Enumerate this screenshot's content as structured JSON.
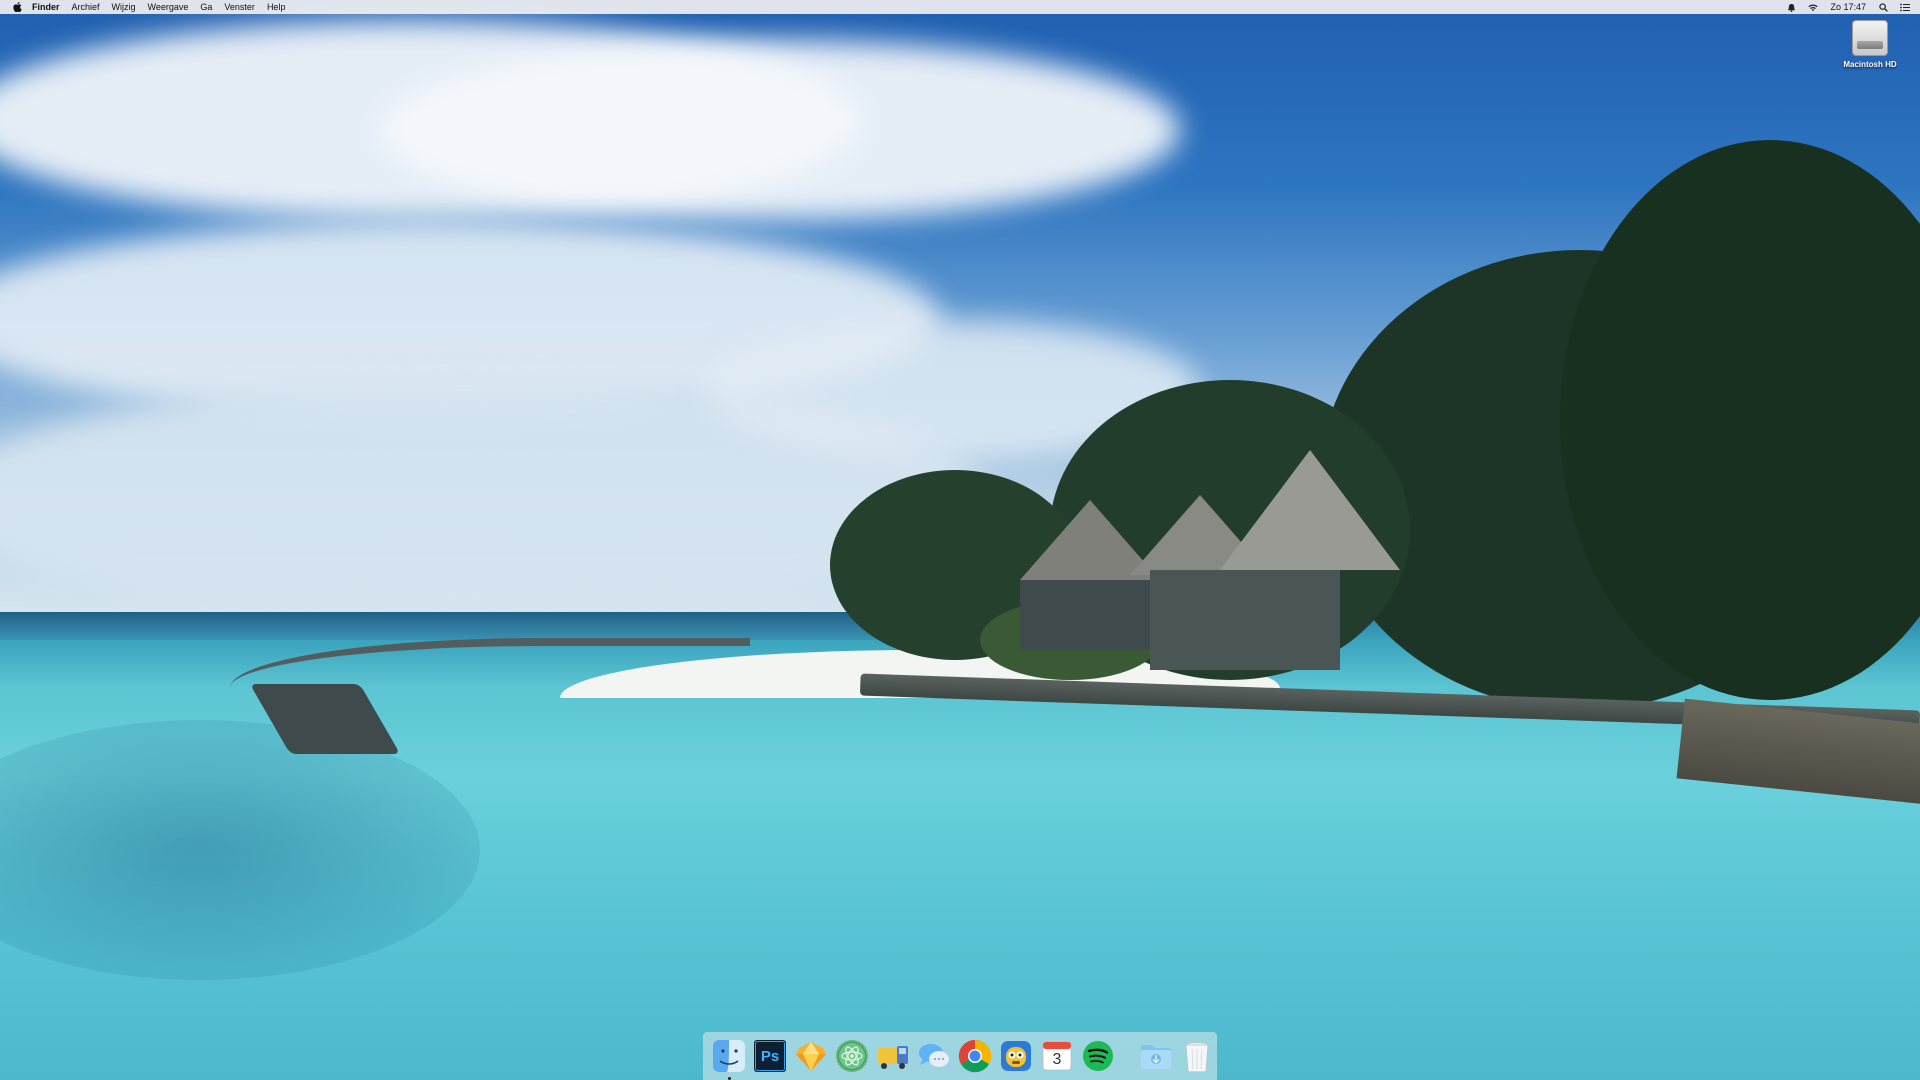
{
  "menubar": {
    "app_name": "Finder",
    "menus": [
      "Archief",
      "Wijzig",
      "Weergave",
      "Ga",
      "Venster",
      "Help"
    ],
    "clock": "Zo 17:47",
    "status_icons": [
      "notification-bell-icon",
      "wifi-icon",
      "search-icon",
      "notification-center-icon"
    ]
  },
  "desktop": {
    "icons": [
      {
        "label": "Macintosh HD",
        "icon": "hard-drive-icon"
      }
    ],
    "wallpaper": "tropical-beach-wallpaper"
  },
  "dock": {
    "apps": [
      {
        "name": "Finder",
        "icon": "finder-icon",
        "running": true
      },
      {
        "name": "Photoshop",
        "icon": "photoshop-icon",
        "label": "Ps",
        "running": false
      },
      {
        "name": "Sketch",
        "icon": "sketch-icon",
        "running": false
      },
      {
        "name": "Atom",
        "icon": "atom-icon",
        "running": false
      },
      {
        "name": "Transmit",
        "icon": "transmit-icon",
        "running": false
      },
      {
        "name": "Messages",
        "icon": "messages-icon",
        "running": false
      },
      {
        "name": "Chrome",
        "icon": "chrome-icon",
        "running": false
      },
      {
        "name": "Tweetbot",
        "icon": "tweetbot-icon",
        "running": false
      },
      {
        "name": "Calendar",
        "icon": "calendar-icon",
        "label": "3",
        "running": false
      },
      {
        "name": "Spotify",
        "icon": "spotify-icon",
        "running": false
      }
    ],
    "folders": [
      {
        "name": "Downloads",
        "icon": "downloads-folder-icon"
      },
      {
        "name": "Trash",
        "icon": "trash-icon"
      }
    ]
  },
  "colors": {
    "menubar_bg": "#eeeef0",
    "dock_bg": "#bee1e8",
    "sky_top": "#1f5fb0",
    "ocean": "#6ad0dc"
  }
}
